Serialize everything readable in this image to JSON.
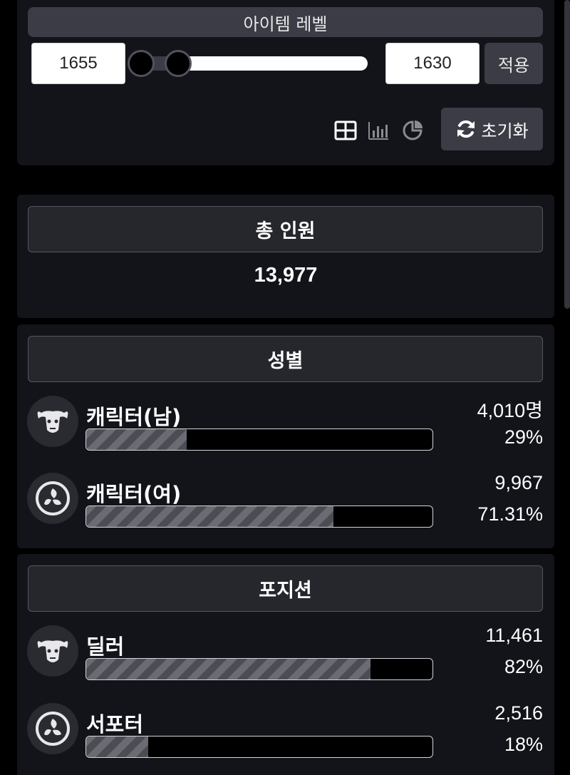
{
  "filter": {
    "title": "아이템 레벨",
    "min_value": "1655",
    "max_value": "1630",
    "apply_label": "적용",
    "reset_label": "초기화",
    "view_icons": [
      "table-icon",
      "bar-chart-icon",
      "pie-chart-icon"
    ]
  },
  "total": {
    "title": "총 인원",
    "value": "13,977"
  },
  "gender": {
    "title": "성별",
    "rows": [
      {
        "label": "캐릭터(남)",
        "count": "4,010명",
        "percent": "29%",
        "fraction": 0.29,
        "icon": "demon-emblem-icon"
      },
      {
        "label": "캐릭터(여)",
        "count": "9,967",
        "percent": "71.31%",
        "fraction": 0.7131,
        "icon": "triskele-emblem-icon"
      }
    ]
  },
  "position": {
    "title": "포지션",
    "rows": [
      {
        "label": "딜러",
        "count": "11,461",
        "percent": "82%",
        "fraction": 0.82,
        "icon": "demon-emblem-icon"
      },
      {
        "label": "서포터",
        "count": "2,516",
        "percent": "18%",
        "fraction": 0.18,
        "icon": "triskele-emblem-icon"
      }
    ]
  },
  "colors": {
    "background": "#000000",
    "panel": "#13141a",
    "button": "#3b3c45",
    "bar_fill": "#6a6b73"
  }
}
